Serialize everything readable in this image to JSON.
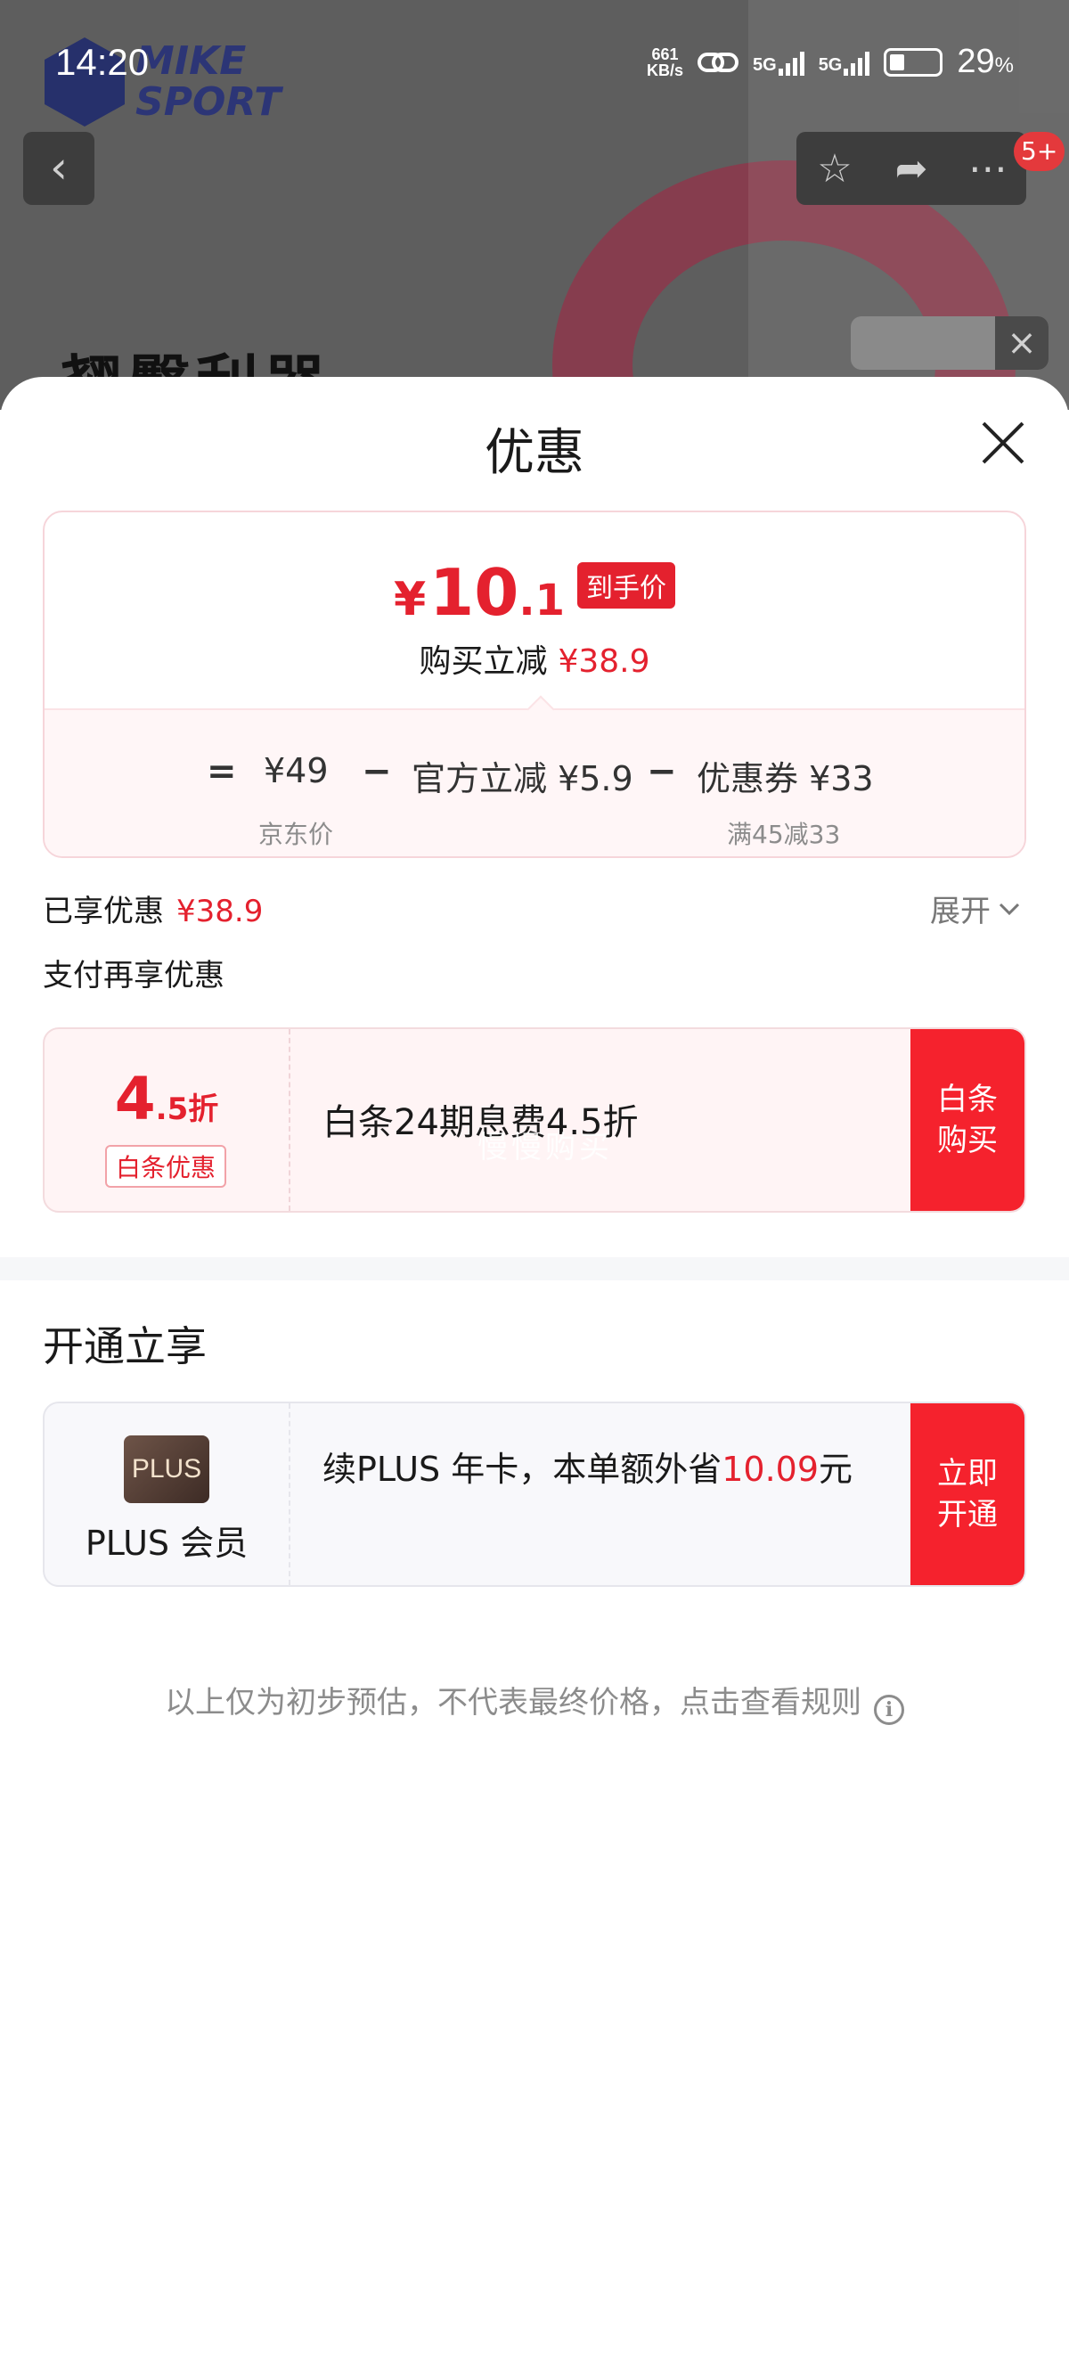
{
  "status_bar": {
    "time": "14:20",
    "net_speed_value": "661",
    "net_speed_unit": "KB/s",
    "sim1": "5G",
    "sim2": "5G",
    "battery": "29",
    "battery_unit": "%"
  },
  "background": {
    "logo_line1": "MIKE",
    "logo_line2": "SPORT",
    "title_partial": "翘臀利器",
    "cart_badge": "5+"
  },
  "sheet": {
    "title": "优惠"
  },
  "price_card": {
    "currency": "¥",
    "final_int": "10",
    "final_dec": ".1",
    "final_tag": "到手价",
    "discount_label": "购买立减",
    "discount_amount": "¥38.9",
    "eq": "=",
    "base_price": "¥49",
    "base_note": "京东价",
    "minus1": "−",
    "official_cut": "官方立减 ¥5.9",
    "minus2": "−",
    "coupon": "优惠券 ¥33",
    "coupon_note": "满45减33"
  },
  "enjoyed": {
    "label": "已享优惠",
    "amount": "¥38.9",
    "expand": "展开"
  },
  "pay_more": {
    "label": "支付再享优惠"
  },
  "baitiao_card": {
    "rate_big": "4",
    "rate_small": ".5折",
    "tag": "白条优惠",
    "description": "白条24期息费4.5折",
    "watermark": "慢慢购买",
    "button_line1": "白条",
    "button_line2": "购买"
  },
  "open_section": {
    "title": "开通立享"
  },
  "plus_card": {
    "logo": "PLUS",
    "name": "PLUS 会员",
    "text_prefix": "续PLUS 年卡，本单额外省",
    "amount": "10.09",
    "text_suffix": "元",
    "button_line1": "立即",
    "button_line2": "开通"
  },
  "footnote": {
    "text": "以上仅为初步预估，不代表最终价格，点击查看规则",
    "icon": "info-icon"
  },
  "colors": {
    "accent_red": "#e4212e",
    "button_red": "#f5222d"
  }
}
